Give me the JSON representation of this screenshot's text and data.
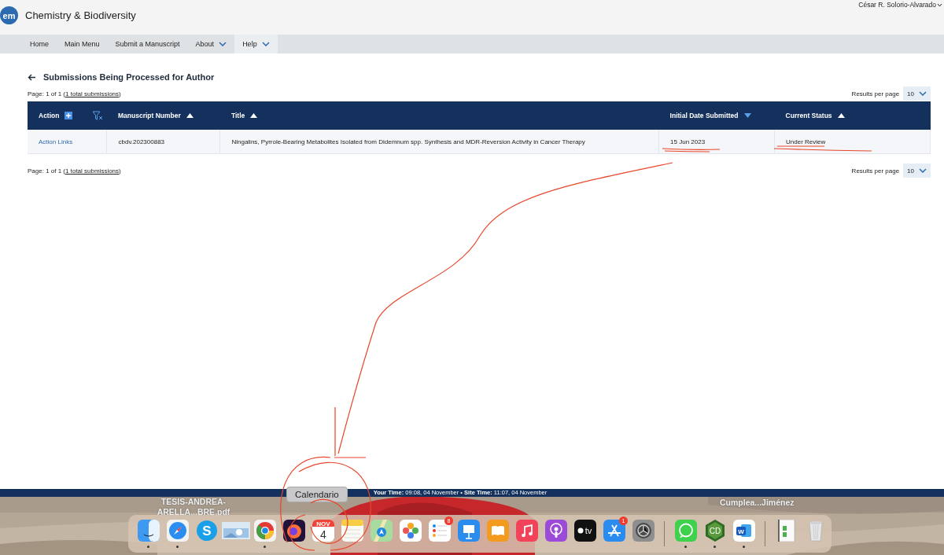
{
  "header": {
    "logo": "em",
    "journal": "Chemistry & Biodiversity",
    "user": "César R. Solorio-Alvarado"
  },
  "nav": [
    {
      "label": "Home",
      "dropdown": false,
      "selected": false
    },
    {
      "label": "Main Menu",
      "dropdown": false,
      "selected": false
    },
    {
      "label": "Submit a Manuscript",
      "dropdown": false,
      "selected": false
    },
    {
      "label": "About",
      "dropdown": true,
      "selected": false
    },
    {
      "label": "Help",
      "dropdown": true,
      "selected": true
    }
  ],
  "page": {
    "title": "Submissions Being Processed for Author",
    "paging": "Page: 1 of 1 (",
    "paging_link": "1 total submissions",
    "paging_end": ")",
    "results_label": "Results per page",
    "results_value": "10"
  },
  "table": {
    "columns": [
      {
        "label": "Action",
        "kind": "action"
      },
      {
        "label": "Manuscript Number",
        "sort_descending": false,
        "kind": "text"
      },
      {
        "label": "Title",
        "sort_descending": false,
        "kind": "text"
      },
      {
        "label": "Initial Date Submitted",
        "sort_descending": true,
        "kind": "text"
      },
      {
        "label": "Current Status",
        "sort_descending": false,
        "kind": "text"
      }
    ],
    "rows": [
      {
        "cells": [
          "Action Links",
          "cbdv.202300883",
          "Ningalins, Pyrrole-Bearing Metabolites Isolated from Didemnum spp. Synthesis and MDR-Reversion Activity in Cancer Therapy",
          "15 Jun 2023",
          "Under Review"
        ]
      }
    ]
  },
  "footer_paging": {
    "paging": "Page: 1 of 1 (",
    "paging_link": "1 total submissions",
    "paging_end": ")",
    "results_label": "Results per page",
    "results_value": "10"
  },
  "status_bar": "**Your Time:** 09:08, 04 November • **Site Time:** 11:07, 04 November",
  "desktop": {
    "files": [
      {
        "name": "TESIS-ANDREA-ARELLA...BRE.pdf"
      },
      {
        "name": "Cumplea...Jiménez"
      }
    ]
  },
  "tooltip": "Calendario",
  "dock": [
    {
      "kind": "finder",
      "running": true
    },
    {
      "kind": "safari",
      "running": true
    },
    {
      "kind": "skype",
      "glyph": "S",
      "running": false
    },
    {
      "kind": "thumbnail",
      "running": false
    },
    {
      "kind": "chrome",
      "running": true
    },
    {
      "kind": "firefox",
      "running": false
    },
    {
      "kind": "calendar",
      "month": "NOV",
      "day": "4",
      "running": false
    },
    {
      "kind": "notes",
      "running": false
    },
    {
      "kind": "maps",
      "running": false
    },
    {
      "kind": "photos",
      "running": false
    },
    {
      "kind": "reminders",
      "badge": "8",
      "running": false
    },
    {
      "kind": "keynote",
      "running": false
    },
    {
      "kind": "books",
      "running": false
    },
    {
      "kind": "music",
      "running": false
    },
    {
      "kind": "podcasts",
      "running": false
    },
    {
      "kind": "tv",
      "glyph": "tv",
      "running": false
    },
    {
      "kind": "appstore",
      "badge": "1",
      "running": false
    },
    {
      "kind": "settings",
      "running": false
    },
    {
      "kind": "separator"
    },
    {
      "kind": "whatsapp",
      "running": true
    },
    {
      "kind": "chemdraw",
      "glyph": "CD",
      "running": true
    },
    {
      "kind": "word",
      "glyph": "W",
      "running": true
    },
    {
      "kind": "separator"
    },
    {
      "kind": "document",
      "running": false
    },
    {
      "kind": "trash",
      "running": false
    }
  ]
}
